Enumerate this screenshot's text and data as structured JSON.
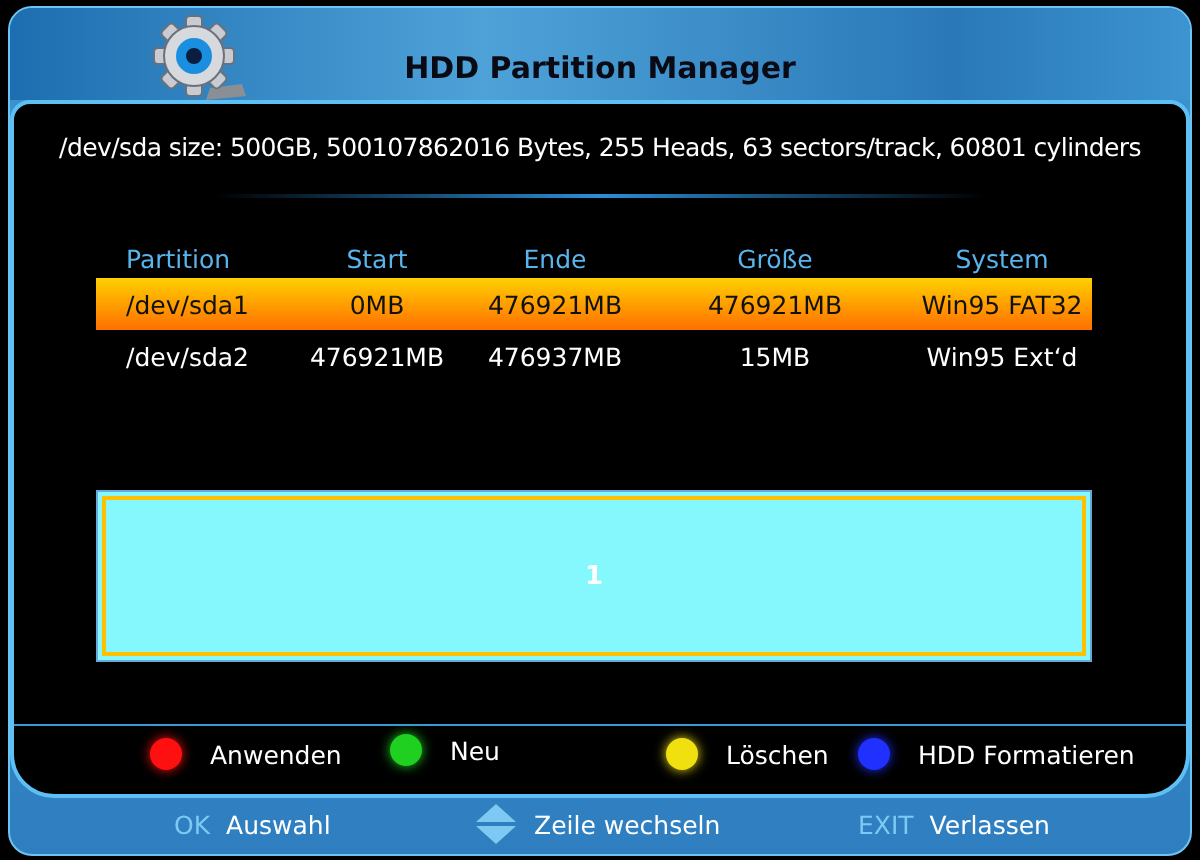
{
  "window": {
    "title": "HDD Partition Manager"
  },
  "disk_info": "/dev/sda size: 500GB, 500107862016 Bytes, 255 Heads, 63 sectors/track, 60801 cylinders",
  "table": {
    "columns": [
      "Partition",
      "Start",
      "Ende",
      "Größe",
      "System"
    ],
    "rows": [
      {
        "cells": [
          "/dev/sda1",
          "0MB",
          "476921MB",
          "476921MB",
          "Win95 FAT32"
        ],
        "selected": true
      },
      {
        "cells": [
          "/dev/sda2",
          "476921MB",
          "476937MB",
          "15MB",
          "Win95 Ext‘d"
        ],
        "selected": false
      }
    ]
  },
  "partition_map": {
    "segments": [
      {
        "label": "1",
        "selected": true
      }
    ]
  },
  "color_keys": [
    {
      "color": "#ff1010",
      "label": "Anwenden"
    },
    {
      "color": "#20d020",
      "label": "Neu"
    },
    {
      "color": "#f0e010",
      "label": "Löschen"
    },
    {
      "color": "#2030ff",
      "label": "HDD Formatieren"
    }
  ],
  "hints": [
    {
      "kind": "text",
      "key": "OK",
      "label": "Auswahl"
    },
    {
      "kind": "updown",
      "label": "Zeile wechseln"
    },
    {
      "kind": "text",
      "key": "EXIT",
      "label": "Verlassen"
    }
  ]
}
